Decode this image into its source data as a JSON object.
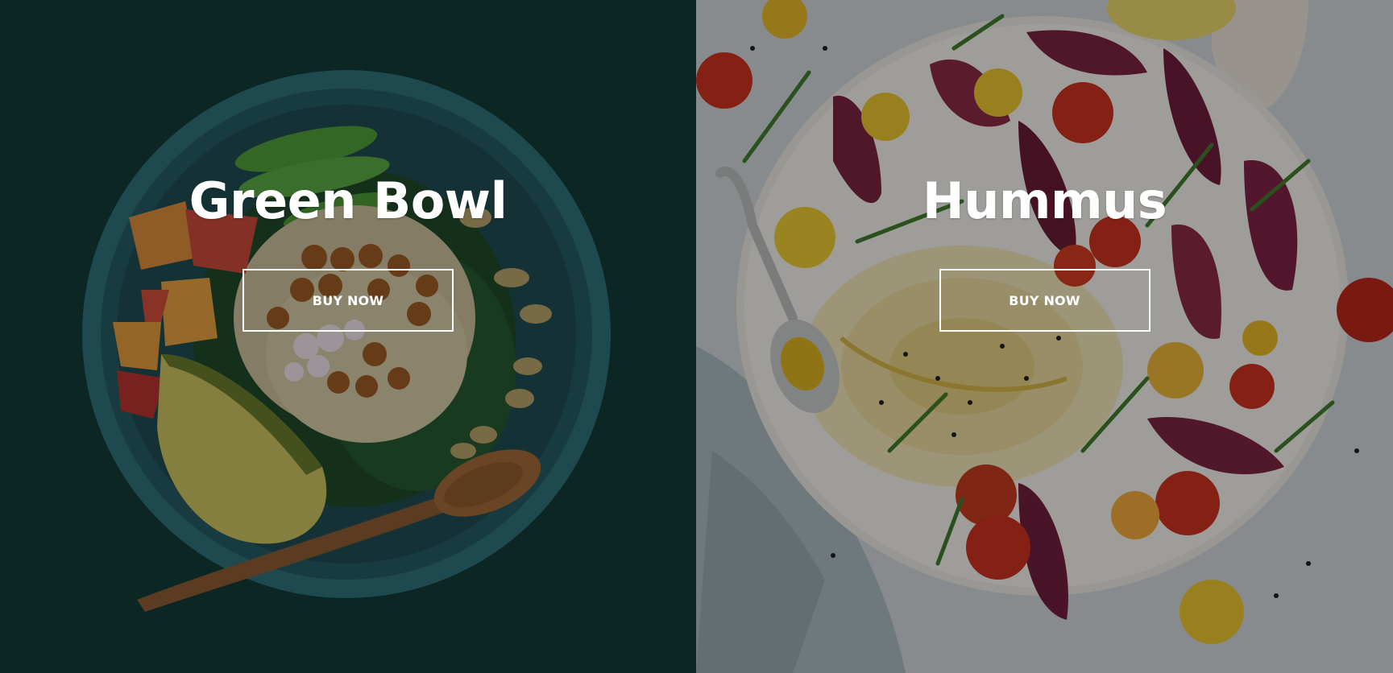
{
  "panels": [
    {
      "title": "Green Bowl",
      "button_label": "BUY NOW",
      "image": "green-bowl-photo"
    },
    {
      "title": "Hummus",
      "button_label": "BUY NOW",
      "image": "hummus-plate-photo"
    }
  ],
  "colors": {
    "left_background": "#0f2a28",
    "right_background": "#c9cfd1",
    "text": "#ffffff",
    "button_border": "#ffffff"
  }
}
